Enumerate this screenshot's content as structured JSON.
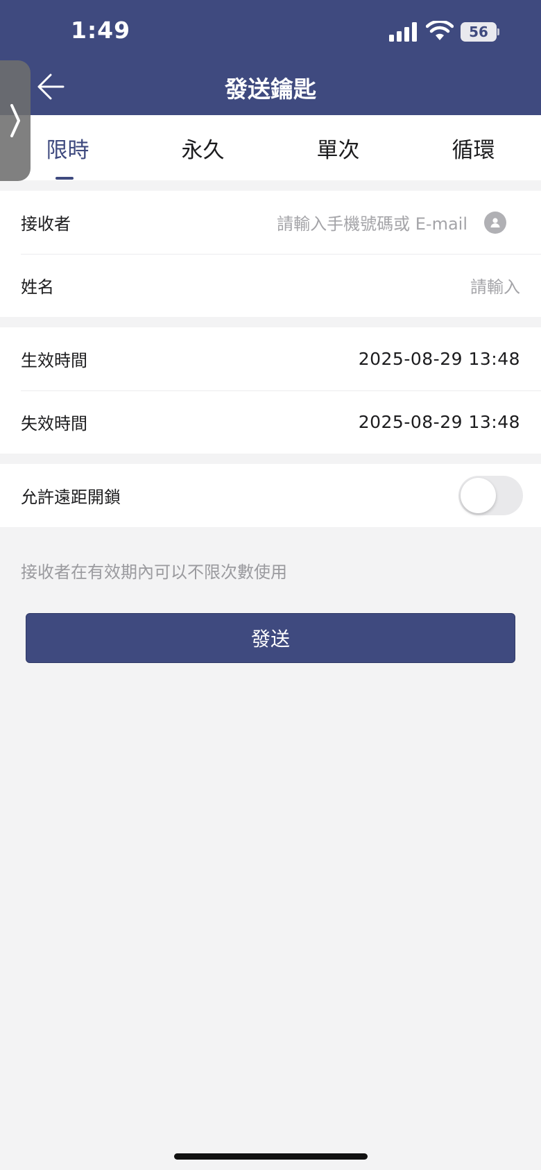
{
  "status_bar": {
    "time": "1:49",
    "battery": "56",
    "icons": [
      "signal-icon",
      "wifi-icon",
      "battery-icon"
    ]
  },
  "header": {
    "title": "發送鑰匙",
    "back_icon": "arrow-left-icon",
    "background": "#3f4a7f"
  },
  "tabs": [
    {
      "label": "限時",
      "active": true
    },
    {
      "label": "永久",
      "active": false
    },
    {
      "label": "單次",
      "active": false
    },
    {
      "label": "循環",
      "active": false
    }
  ],
  "recipient": {
    "receiver_label": "接收者",
    "receiver_placeholder": "請輸入手機號碼或 E-mail",
    "contact_icon": "contact-book-icon",
    "name_label": "姓名",
    "name_placeholder": "請輸入"
  },
  "time": {
    "start_label": "生效時間",
    "start_value": "2025-08-29 13:48",
    "end_label": "失效時間",
    "end_value": "2025-08-29 13:48"
  },
  "remote": {
    "label": "允許遠距開鎖",
    "enabled": false
  },
  "hint": "接收者在有效期內可以不限次數使用",
  "send_button": "發送",
  "colors": {
    "accent": "#3f4a7f",
    "background": "#f3f3f4",
    "placeholder": "#a4a4a8"
  }
}
